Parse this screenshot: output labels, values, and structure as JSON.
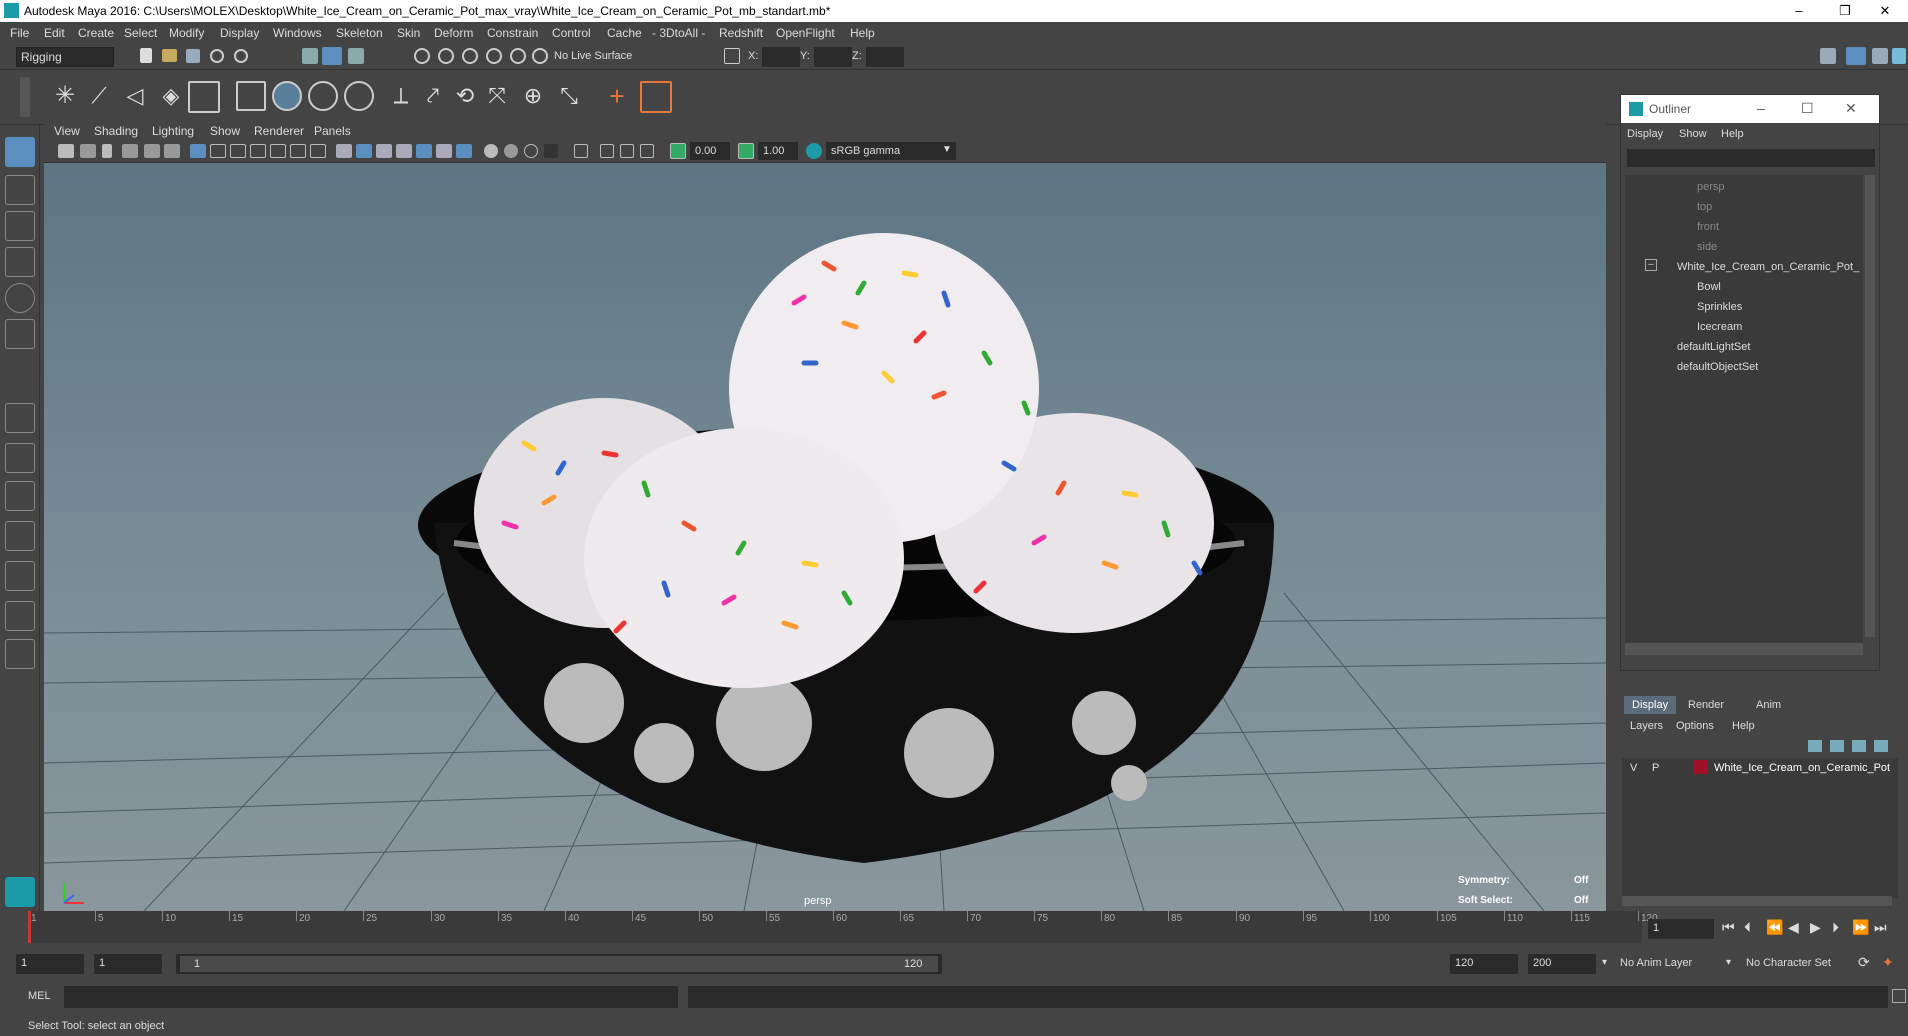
{
  "window": {
    "title": "Autodesk Maya 2016: C:\\Users\\MOLEX\\Desktop\\White_Ice_Cream_on_Ceramic_Pot_max_vray\\White_Ice_Cream_on_Ceramic_Pot_mb_standart.mb*",
    "minimize": "–",
    "restore": "❐",
    "close": "✕"
  },
  "menubar": [
    "File",
    "Edit",
    "Create",
    "Select",
    "Modify",
    "Display",
    "Windows",
    "Skeleton",
    "Skin",
    "Deform",
    "Constrain",
    "Control",
    "Cache",
    "- 3DtoAll -",
    "Redshift",
    "OpenFlight",
    "Help"
  ],
  "statusline": {
    "mode": "Rigging",
    "live_surface": "No Live Surface",
    "x_label": "X:",
    "y_label": "Y:",
    "z_label": "Z:"
  },
  "viewport": {
    "menu": [
      "View",
      "Shading",
      "Lighting",
      "Show",
      "Renderer",
      "Panels"
    ],
    "exposure": "0.00",
    "gamma": "1.00",
    "colorspace": "sRGB gamma",
    "camera_label": "persp",
    "symmetry_label": "Symmetry:",
    "symmetry_value": "Off",
    "soft_select_label": "Soft Select:",
    "soft_select_value": "Off"
  },
  "outliner": {
    "title": "Outliner",
    "menu": [
      "Display",
      "Show",
      "Help"
    ],
    "items": [
      {
        "label": "persp",
        "dim": true
      },
      {
        "label": "top",
        "dim": true
      },
      {
        "label": "front",
        "dim": true
      },
      {
        "label": "side",
        "dim": true
      },
      {
        "label": "White_Ice_Cream_on_Ceramic_Pot_",
        "dim": false
      },
      {
        "label": "Bowl",
        "dim": false
      },
      {
        "label": "Sprinkles",
        "dim": false
      },
      {
        "label": "Icecream",
        "dim": false
      },
      {
        "label": "defaultLightSet",
        "dim": false
      },
      {
        "label": "defaultObjectSet",
        "dim": false
      }
    ]
  },
  "layers": {
    "tabs": [
      "Display",
      "Render",
      "Anim"
    ],
    "menu": [
      "Layers",
      "Options",
      "Help"
    ],
    "row": {
      "v": "V",
      "p": "P",
      "name": "White_Ice_Cream_on_Ceramic_Pot",
      "color": "#a0102a"
    }
  },
  "timeline": {
    "ticks": [
      "1",
      "5",
      "10",
      "15",
      "20",
      "25",
      "30",
      "35",
      "40",
      "45",
      "50",
      "55",
      "60",
      "65",
      "70",
      "75",
      "80",
      "85",
      "90",
      "95",
      "100",
      "105",
      "110",
      "115",
      "120"
    ],
    "current_frame": "1"
  },
  "range": {
    "start": "1",
    "playback_start": "1",
    "slider_start": "1",
    "slider_end": "120",
    "playback_end": "120",
    "end": "200",
    "anim_layer": "No Anim Layer",
    "character_set": "No Character Set"
  },
  "cmdline": {
    "label": "MEL"
  },
  "helpline": {
    "text": "Select Tool: select an object"
  }
}
